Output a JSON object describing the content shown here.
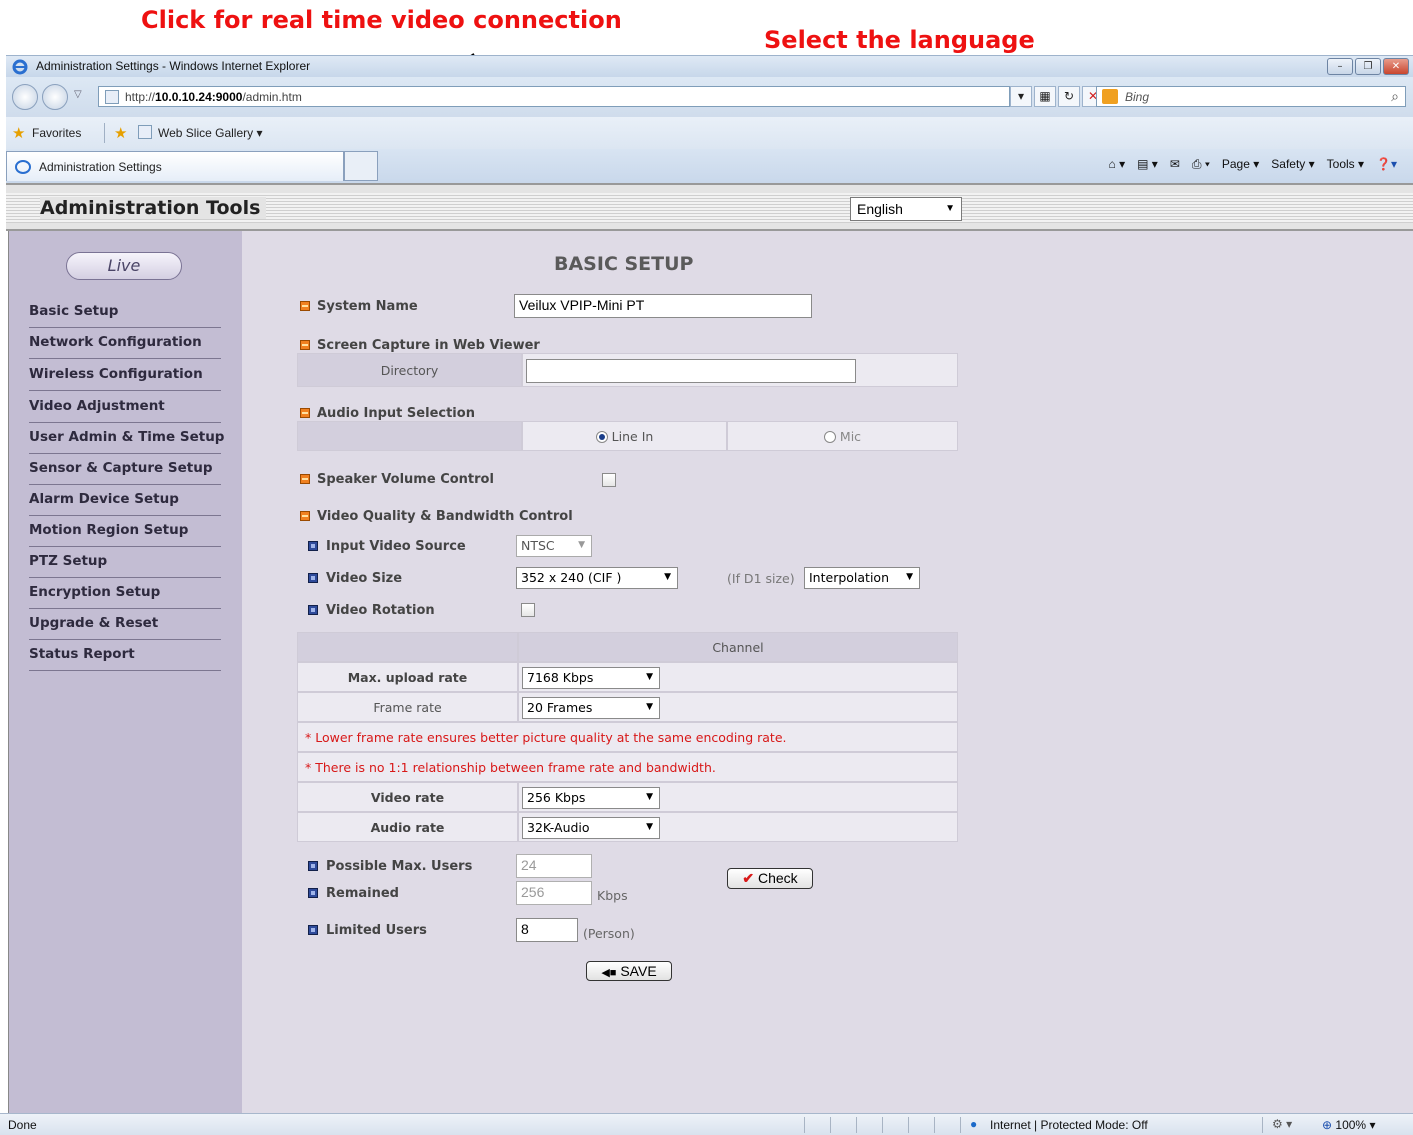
{
  "annotations": {
    "live_note": "Click for real time video connection",
    "language_note": "Select the language"
  },
  "browser": {
    "window_title": "Administration Settings - Windows Internet Explorer",
    "url_prefix": "http://",
    "url_host": "10.0.10.24:9000",
    "url_path": "/admin.htm",
    "search_placeholder": "Bing",
    "favorites_label": "Favorites",
    "web_slice_label": "Web Slice Gallery",
    "tab_title": "Administration Settings",
    "commands": [
      "Page",
      "Safety",
      "Tools"
    ],
    "status_left": "Done",
    "status_zone": "Internet | Protected Mode: Off",
    "zoom": "100%"
  },
  "header": {
    "title": "Administration Tools",
    "language": "English"
  },
  "sidebar": {
    "live_label": "Live",
    "items": [
      {
        "label": "Basic Setup"
      },
      {
        "label": "Network Configuration"
      },
      {
        "label": "Wireless Configuration"
      },
      {
        "label": "Video Adjustment"
      },
      {
        "label": "User Admin & Time Setup"
      },
      {
        "label": "Sensor & Capture Setup"
      },
      {
        "label": "Alarm Device Setup"
      },
      {
        "label": "Motion Region Setup"
      },
      {
        "label": "PTZ Setup"
      },
      {
        "label": "Encryption Setup"
      },
      {
        "label": "Upgrade & Reset"
      },
      {
        "label": "Status Report"
      }
    ]
  },
  "main": {
    "heading": "BASIC SETUP",
    "system_name": {
      "label": "System Name",
      "value": "Veilux VPIP-Mini PT"
    },
    "screen_capture": {
      "label": "Screen Capture in Web Viewer",
      "directory_label": "Directory",
      "directory_value": ""
    },
    "audio_input": {
      "label": "Audio Input Selection",
      "options": [
        "Line In",
        "Mic"
      ],
      "selected": "Line In"
    },
    "speaker_volume": {
      "label": "Speaker Volume Control",
      "checked": false
    },
    "video_quality": {
      "label": "Video Quality & Bandwidth Control",
      "input_source": {
        "label": "Input Video Source",
        "value": "NTSC"
      },
      "video_size": {
        "label": "Video Size",
        "value": "352 x 240 (CIF )",
        "d1_label": "(If D1 size)",
        "d1_value": "Interpolation"
      },
      "video_rotation": {
        "label": "Video Rotation",
        "checked": false
      }
    },
    "channel_table": {
      "column_header": "Channel",
      "max_upload": {
        "label": "Max. upload rate",
        "value": "7168 Kbps"
      },
      "frame_rate": {
        "label": "Frame rate",
        "value": "20 Frames"
      },
      "note1": "* Lower frame rate ensures better picture quality at the same encoding rate.",
      "note2": "* There is no 1:1 relationship between frame rate and bandwidth.",
      "video_rate": {
        "label": "Video rate",
        "value": "256 Kbps"
      },
      "audio_rate": {
        "label": "Audio rate",
        "value": "32K-Audio"
      }
    },
    "users": {
      "possible_max": {
        "label": "Possible Max. Users",
        "value": "24"
      },
      "remained": {
        "label": "Remained",
        "value": "256",
        "unit": "Kbps"
      },
      "check_label": "Check",
      "limited": {
        "label": "Limited Users",
        "value": "8",
        "unit": "(Person)"
      }
    },
    "save_label": "SAVE"
  }
}
